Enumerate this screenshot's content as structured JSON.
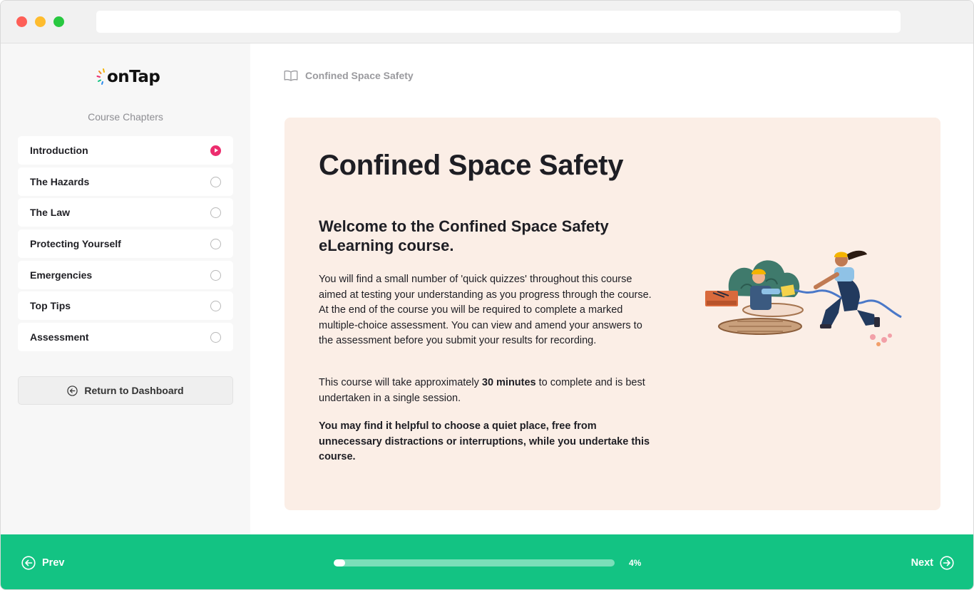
{
  "brand": {
    "name": "onTap"
  },
  "sidebar": {
    "heading": "Course Chapters",
    "chapters": [
      {
        "label": "Introduction",
        "status": "current"
      },
      {
        "label": "The Hazards",
        "status": "not-started"
      },
      {
        "label": "The Law",
        "status": "not-started"
      },
      {
        "label": "Protecting Yourself",
        "status": "not-started"
      },
      {
        "label": "Emergencies",
        "status": "not-started"
      },
      {
        "label": "Top Tips",
        "status": "not-started"
      },
      {
        "label": "Assessment",
        "status": "not-started"
      }
    ],
    "return_label": "Return to Dashboard",
    "return_icon": "arrow-left-circle-icon"
  },
  "breadcrumb": {
    "icon": "book-open-icon",
    "label": "Confined Space Safety"
  },
  "content": {
    "title": "Confined Space Safety",
    "subtitle": "Welcome to the Confined Space Safety eLearning course.",
    "paragraph1": "You will find a small number of 'quick quizzes' throughout this course aimed at testing your understanding as you progress through the course.  At the end of the course you will be required to complete a marked multiple-choice assessment. You can view and amend your answers to the assessment before you submit your results for recording.",
    "paragraph2_before": "This course will take approximately ",
    "paragraph2_bold": "30 minutes",
    "paragraph2_after": " to complete and is best undertaken in a single session.",
    "paragraph3": "You may find it helpful to choose a quiet place, free from unnecessary distractions or interruptions, while you undertake this course."
  },
  "footer": {
    "prev_label": "Prev",
    "next_label": "Next",
    "progress_percent": 4,
    "progress_label": "4%"
  },
  "colors": {
    "accent_green": "#13c383",
    "active_chapter": "#ec2d6e",
    "card_background": "#fbeee6"
  }
}
